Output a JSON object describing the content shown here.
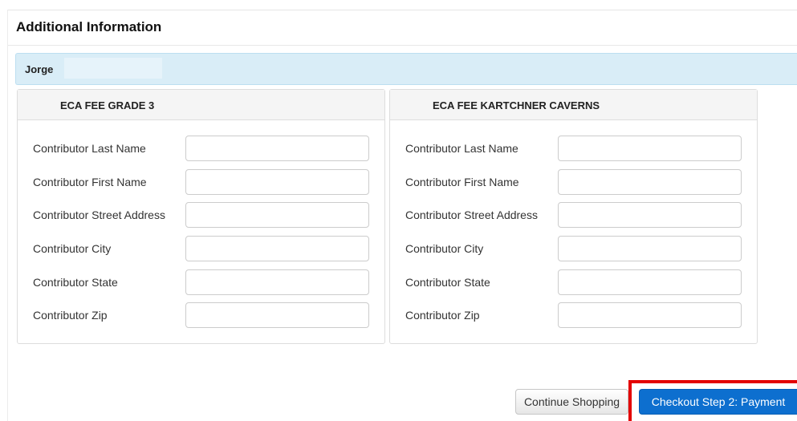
{
  "panel": {
    "title": "Additional Information"
  },
  "student": {
    "name": "Jorge"
  },
  "fees": [
    {
      "title": "ECA FEE GRADE 3",
      "fields": [
        {
          "label": "Contributor Last Name",
          "value": ""
        },
        {
          "label": "Contributor First Name",
          "value": ""
        },
        {
          "label": "Contributor Street Address",
          "value": ""
        },
        {
          "label": "Contributor City",
          "value": ""
        },
        {
          "label": "Contributor State",
          "value": ""
        },
        {
          "label": "Contributor Zip",
          "value": ""
        }
      ]
    },
    {
      "title": "ECA FEE KARTCHNER CAVERNS",
      "fields": [
        {
          "label": "Contributor Last Name",
          "value": ""
        },
        {
          "label": "Contributor First Name",
          "value": ""
        },
        {
          "label": "Contributor Street Address",
          "value": ""
        },
        {
          "label": "Contributor City",
          "value": ""
        },
        {
          "label": "Contributor State",
          "value": ""
        },
        {
          "label": "Contributor Zip",
          "value": ""
        }
      ]
    }
  ],
  "actions": {
    "continue_label": "Continue Shopping",
    "checkout_label": "Checkout Step 2: Payment"
  },
  "colors": {
    "student_bar": "#d9edf7",
    "checkout_button": "#0d6fcf",
    "highlight": "#e30000"
  }
}
